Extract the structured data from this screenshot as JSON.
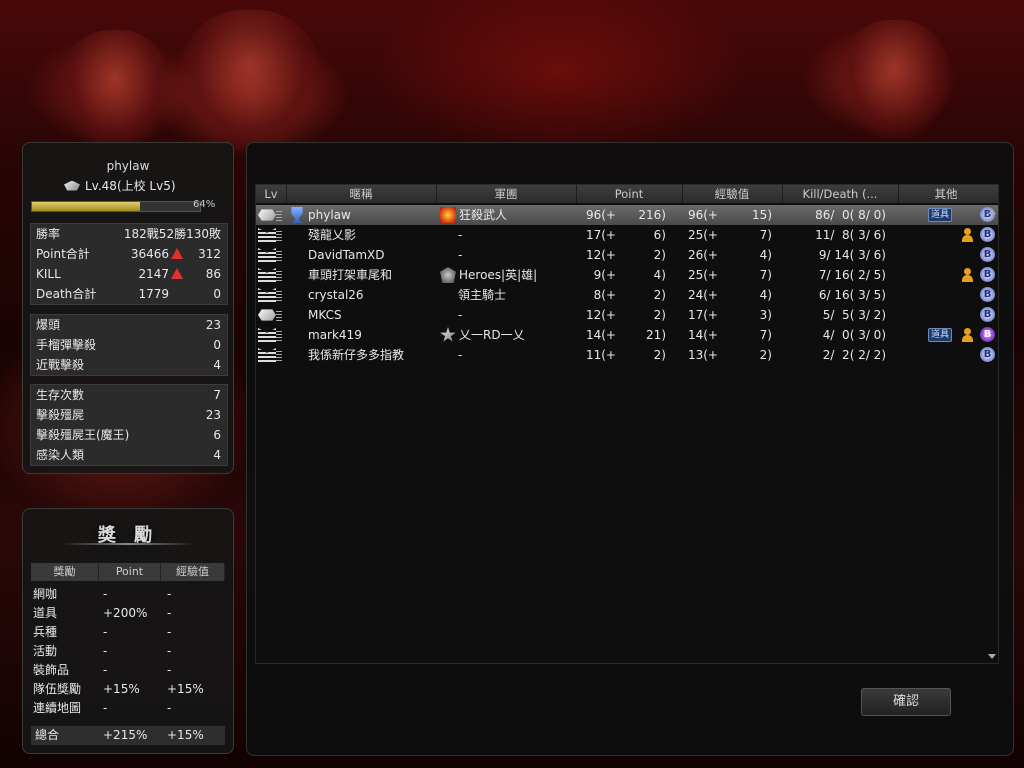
{
  "player": {
    "name": "phylaw",
    "level_text": "Lv.48(上校 Lv5)",
    "xp_percent_text": "64%",
    "xp_fraction": 0.64,
    "stats_main": [
      {
        "label": "勝率",
        "value": "182戰52勝130敗"
      },
      {
        "label": "Point合計",
        "value": "36466",
        "delta": "312"
      },
      {
        "label": "KILL",
        "value": "2147",
        "delta": "86"
      },
      {
        "label": "Death合計",
        "value": "1779",
        "delta": "0"
      }
    ],
    "stats_combat": [
      {
        "label": "爆頭",
        "value": "23"
      },
      {
        "label": "手榴彈擊殺",
        "value": "0"
      },
      {
        "label": "近戰擊殺",
        "value": "4"
      }
    ],
    "stats_zombie": [
      {
        "label": "生存次數",
        "value": "7"
      },
      {
        "label": "擊殺殭屍",
        "value": "23"
      },
      {
        "label": "擊殺殭屍王(魔王)",
        "value": "6"
      },
      {
        "label": "感染人類",
        "value": "4"
      }
    ]
  },
  "reward": {
    "title": "獎 勵",
    "headers": [
      "獎勵",
      "Point",
      "經驗值"
    ],
    "rows": [
      {
        "label": "網咖",
        "point": "-",
        "exp": "-"
      },
      {
        "label": "道具",
        "point": "+200%",
        "exp": "-"
      },
      {
        "label": "兵種",
        "point": "-",
        "exp": "-"
      },
      {
        "label": "活動",
        "point": "-",
        "exp": "-"
      },
      {
        "label": "裝飾品",
        "point": "-",
        "exp": "-"
      },
      {
        "label": "隊伍獎勵",
        "point": "+15%",
        "exp": "+15%"
      },
      {
        "label": "連續地圖",
        "point": "-",
        "exp": "-"
      }
    ],
    "total": {
      "label": "總合",
      "point": "+215%",
      "exp": "+15%"
    }
  },
  "table": {
    "headers": [
      "Lv",
      "暱稱",
      "軍團",
      "Point",
      "經驗值",
      "Kill/Death (...",
      "其他"
    ],
    "rows": [
      {
        "name": "phylaw",
        "clan": "狂殺武人",
        "point": "96(+",
        "point_gain": "216)",
        "exp": "96(+",
        "exp_gain": "15)",
        "kd": "86/  0( 8/ 0)",
        "item": "道具",
        "person": false,
        "badge": "B",
        "selected": true
      },
      {
        "name": "殘龍乂影",
        "clan": "-",
        "point": "17(+",
        "point_gain": "6)",
        "exp": "25(+",
        "exp_gain": "7)",
        "kd": "11/  8( 3/ 6)",
        "item": "",
        "person": true,
        "badge": "B",
        "selected": false
      },
      {
        "name": "DavidTamXD",
        "clan": "-",
        "point": "12(+",
        "point_gain": "2)",
        "exp": "26(+",
        "exp_gain": "4)",
        "kd": "9/ 14( 3/ 6)",
        "item": "",
        "person": false,
        "badge": "B",
        "selected": false
      },
      {
        "name": "車頭打架車尾和",
        "clan": "Heroes|英|雄|",
        "point": "9(+",
        "point_gain": "4)",
        "exp": "25(+",
        "exp_gain": "7)",
        "kd": "7/ 16( 2/ 5)",
        "item": "",
        "person": true,
        "badge": "B",
        "selected": false
      },
      {
        "name": "crystal26",
        "clan": "領主騎士",
        "point": "8(+",
        "point_gain": "2)",
        "exp": "24(+",
        "exp_gain": "4)",
        "kd": "6/ 16( 3/ 5)",
        "item": "",
        "person": false,
        "badge": "B",
        "selected": false
      },
      {
        "name": "MKCS",
        "clan": "-",
        "point": "12(+",
        "point_gain": "2)",
        "exp": "17(+",
        "exp_gain": "3)",
        "kd": "5/  5( 3/ 2)",
        "item": "",
        "person": false,
        "badge": "B",
        "selected": false
      },
      {
        "name": "mark419",
        "clan": "乂一RD一乂",
        "point": "14(+",
        "point_gain": "21)",
        "exp": "14(+",
        "exp_gain": "7)",
        "kd": "4/  0( 3/ 0)",
        "item": "道具",
        "person": true,
        "badge": "B",
        "selected": false
      },
      {
        "name": "我係新仔多多指教",
        "clan": "-",
        "point": "11(+",
        "point_gain": "2)",
        "exp": "13(+",
        "exp_gain": "2)",
        "kd": "2/  2( 2/ 2)",
        "item": "",
        "person": false,
        "badge": "B",
        "selected": false
      }
    ]
  },
  "confirm_label": "確認"
}
